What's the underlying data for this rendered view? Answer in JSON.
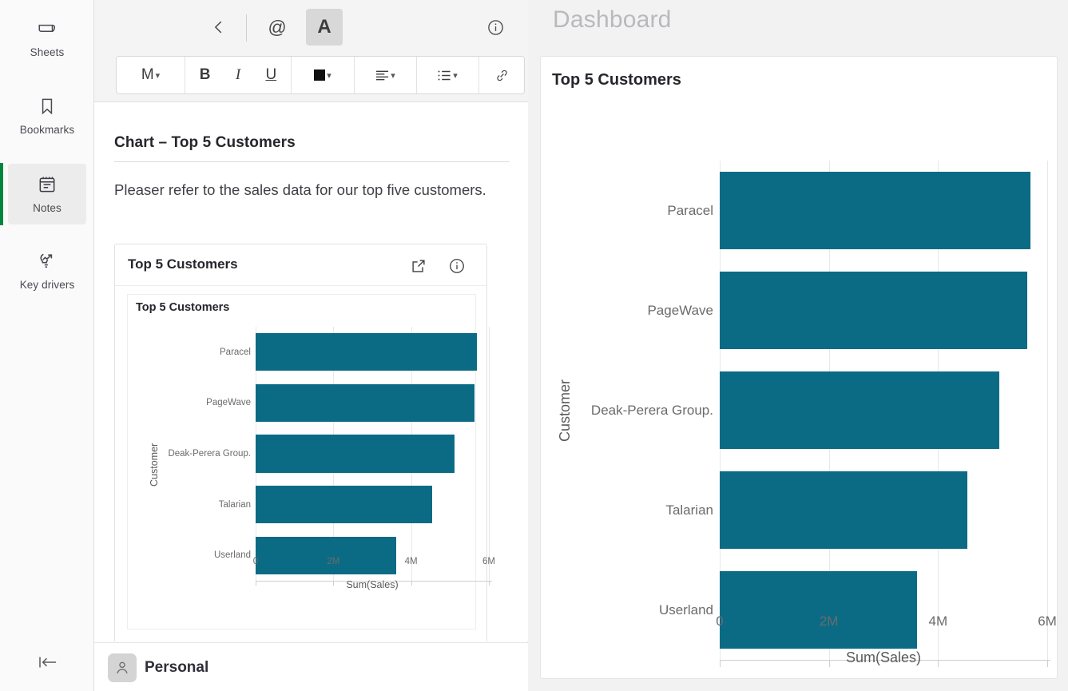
{
  "rail": {
    "items": [
      {
        "label": "Sheets",
        "icon": "sheets-icon",
        "active": false
      },
      {
        "label": "Bookmarks",
        "icon": "bookmark-icon",
        "active": false
      },
      {
        "label": "Notes",
        "icon": "notes-icon",
        "active": true
      },
      {
        "label": "Key drivers",
        "icon": "key-drivers-icon",
        "active": false
      }
    ],
    "collapse_icon": "collapse-panel-icon",
    "accent_color": "#00873d"
  },
  "notes_toolbar": {
    "back_icon": "chevron-left-icon",
    "mention_label": "@",
    "text_format_label": "A",
    "info_icon": "info-circle-icon",
    "expand_icon": "collapse-right-icon",
    "more_icon": "more-options-icon",
    "format_bar": {
      "size_label": "M",
      "bold_label": "B",
      "italic_label": "I",
      "underline_label": "U",
      "color_swatch": "#111111",
      "align_icon": "align-left-icon",
      "list_icon": "bullet-list-icon",
      "link_icon": "link-icon"
    }
  },
  "note": {
    "title": "Chart – Top 5 Customers",
    "body_text": "Pleaser refer to the sales data for our top five customers.",
    "embedded_card": {
      "title": "Top 5 Customers",
      "open_icon": "open-external-icon",
      "info_icon": "info-circle-icon"
    }
  },
  "note_footer": {
    "avatar_icon": "user-avatar-icon",
    "space_name": "Personal"
  },
  "dashboard": {
    "title": "Dashboard",
    "card_title": "Top 5 Customers"
  },
  "colors": {
    "bar": "#0b6b85",
    "grid": "#e8e8e8",
    "axis": "#cfcfcf",
    "accent_green": "#00873d"
  },
  "chart_data": [
    {
      "id": "chart-small",
      "type": "bar",
      "orientation": "horizontal",
      "title": "Top 5 Customers",
      "categories": [
        "Paracel",
        "PageWave",
        "Deak-Perera Group.",
        "Talarian",
        "Userland"
      ],
      "values": [
        5690000,
        5630000,
        5120000,
        4540000,
        3610000
      ],
      "xlabel": "Sum(Sales)",
      "ylabel": "Customer",
      "xlim": [
        0,
        6000000
      ],
      "xticks": [
        0,
        2000000,
        4000000,
        6000000
      ],
      "xticklabels": [
        "0",
        "2M",
        "4M",
        "6M"
      ],
      "grid": true,
      "legend": false,
      "bar_color": "#0b6b85"
    },
    {
      "id": "chart-big",
      "type": "bar",
      "orientation": "horizontal",
      "title": "Top 5 Customers",
      "categories": [
        "Paracel",
        "PageWave",
        "Deak-Perera Group.",
        "Talarian",
        "Userland"
      ],
      "values": [
        5690000,
        5630000,
        5120000,
        4540000,
        3610000
      ],
      "xlabel": "Sum(Sales)",
      "ylabel": "Customer",
      "xlim": [
        0,
        6000000
      ],
      "xticks": [
        0,
        2000000,
        4000000,
        6000000
      ],
      "xticklabels": [
        "0",
        "2M",
        "4M",
        "6M"
      ],
      "grid": true,
      "legend": false,
      "bar_color": "#0b6b85"
    }
  ]
}
